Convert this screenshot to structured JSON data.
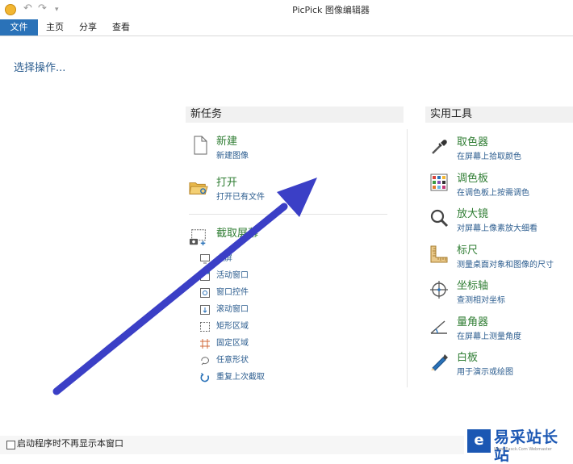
{
  "window": {
    "title": "PicPick 图像编辑器"
  },
  "quick_access": {
    "more_glyph": "▾"
  },
  "menu": [
    {
      "label": "文件",
      "active": true
    },
    {
      "label": "主页",
      "active": false
    },
    {
      "label": "分享",
      "active": false
    },
    {
      "label": "查看",
      "active": false
    }
  ],
  "hint": "选择操作...",
  "new_task": {
    "heading": "新任务",
    "new": {
      "title": "新建",
      "subtitle": "新建图像",
      "icon": "new-file-icon"
    },
    "open": {
      "title": "打开",
      "subtitle": "打开已有文件",
      "icon": "open-folder-icon"
    },
    "capture": {
      "title": "截取屏幕",
      "icon": "screen-capture-icon",
      "items": [
        {
          "label": "全屏",
          "icon": "fullscreen-icon"
        },
        {
          "label": "活动窗口",
          "icon": "active-window-icon"
        },
        {
          "label": "窗口控件",
          "icon": "window-control-icon"
        },
        {
          "label": "滚动窗口",
          "icon": "scrolling-window-icon"
        },
        {
          "label": "矩形区域",
          "icon": "rectangle-region-icon"
        },
        {
          "label": "固定区域",
          "icon": "fixed-region-icon"
        },
        {
          "label": "任意形状",
          "icon": "freehand-shape-icon"
        },
        {
          "label": "重复上次截取",
          "icon": "repeat-capture-icon"
        }
      ]
    }
  },
  "tools": {
    "heading": "实用工具",
    "items": [
      {
        "title": "取色器",
        "subtitle": "在屏幕上拾取颜色",
        "icon": "eyedropper-icon"
      },
      {
        "title": "调色板",
        "subtitle": "在调色板上按需调色",
        "icon": "palette-icon"
      },
      {
        "title": "放大镜",
        "subtitle": "对屏幕上像素放大细看",
        "icon": "magnifier-icon"
      },
      {
        "title": "标尺",
        "subtitle": "测量桌面对象和图像的尺寸",
        "icon": "ruler-icon"
      },
      {
        "title": "坐标轴",
        "subtitle": "查测相对坐标",
        "icon": "crosshair-icon"
      },
      {
        "title": "量角器",
        "subtitle": "在屏幕上测量角度",
        "icon": "protractor-icon"
      },
      {
        "title": "白板",
        "subtitle": "用于演示或绘图",
        "icon": "whiteboard-pen-icon"
      }
    ]
  },
  "footer": {
    "checkbox_label": "启动程序时不再显示本窗口",
    "checked": false
  },
  "watermark": {
    "name": "易采站长站",
    "url": "Www.Easck.Com Webmaster",
    "logo_letter": "e"
  },
  "colors": {
    "accent": "#2a72b8",
    "title_green": "#2f7d33",
    "link_blue": "#2c5d8f",
    "arrow": "#3b3fc6"
  }
}
